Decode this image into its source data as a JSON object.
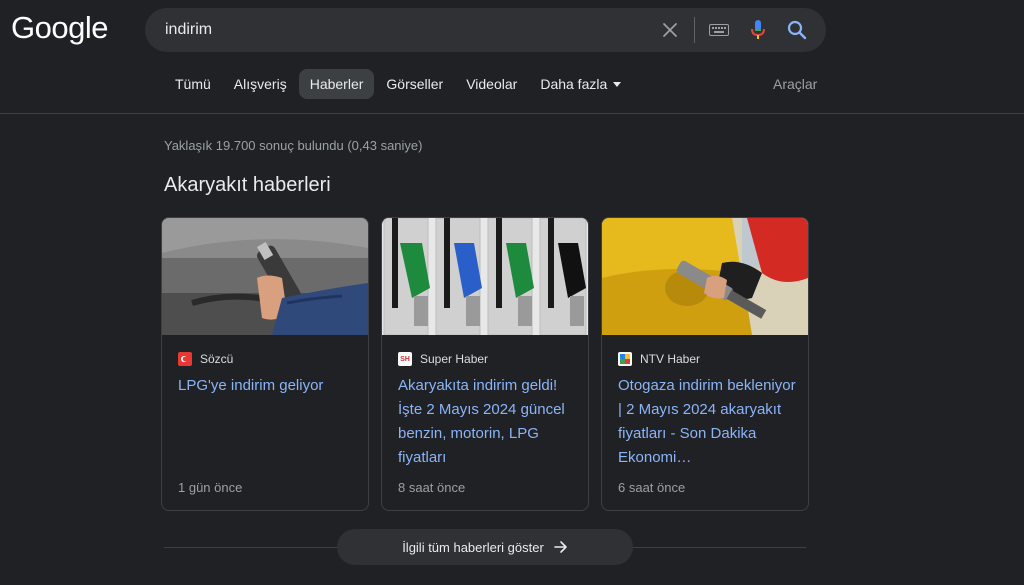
{
  "header": {
    "logo_text": "Google",
    "search": {
      "value": "indirim"
    }
  },
  "tabs": [
    {
      "label": "Tümü",
      "active": false
    },
    {
      "label": "Alışveriş",
      "active": false
    },
    {
      "label": "Haberler",
      "active": true
    },
    {
      "label": "Görseller",
      "active": false
    },
    {
      "label": "Videolar",
      "active": false
    },
    {
      "label": "Daha fazla",
      "active": false
    }
  ],
  "tools_label": "Araçlar",
  "result_stats": "Yaklaşık 19.700 sonuç bulundu (0,43 saniye)",
  "section_title": "Akaryakıt haberleri",
  "cards": [
    {
      "source": "Sözcü",
      "title": "LPG'ye indirim geliyor",
      "time": "1 gün önce",
      "favicon_color": "#e53935",
      "image": "hand-holding-fuel-nozzle-at-car"
    },
    {
      "source": "Super Haber",
      "title": "Akaryakıta indirim geldi! İşte 2 Mayıs 2024 güncel benzin, motorin, LPG fiyatları",
      "time": "8 saat önce",
      "favicon_color": "#ffffff",
      "favicon_text": "SH",
      "image": "fuel-pump-nozzles-green-blue"
    },
    {
      "source": "NTV Haber",
      "title": "Otogaza indirim bekleniyor | 2 Mayıs 2024 akaryakıt fiyatları - Son Dakika Ekonomi…",
      "time": "6 saat önce",
      "favicon_color": "#ffffff",
      "image": "fueling-yellow-car"
    }
  ],
  "more_news_label": "İlgili tüm haberleri göster",
  "colors": {
    "background": "#202124",
    "link": "#8ab4f8",
    "active_tab": "#3c4043"
  }
}
